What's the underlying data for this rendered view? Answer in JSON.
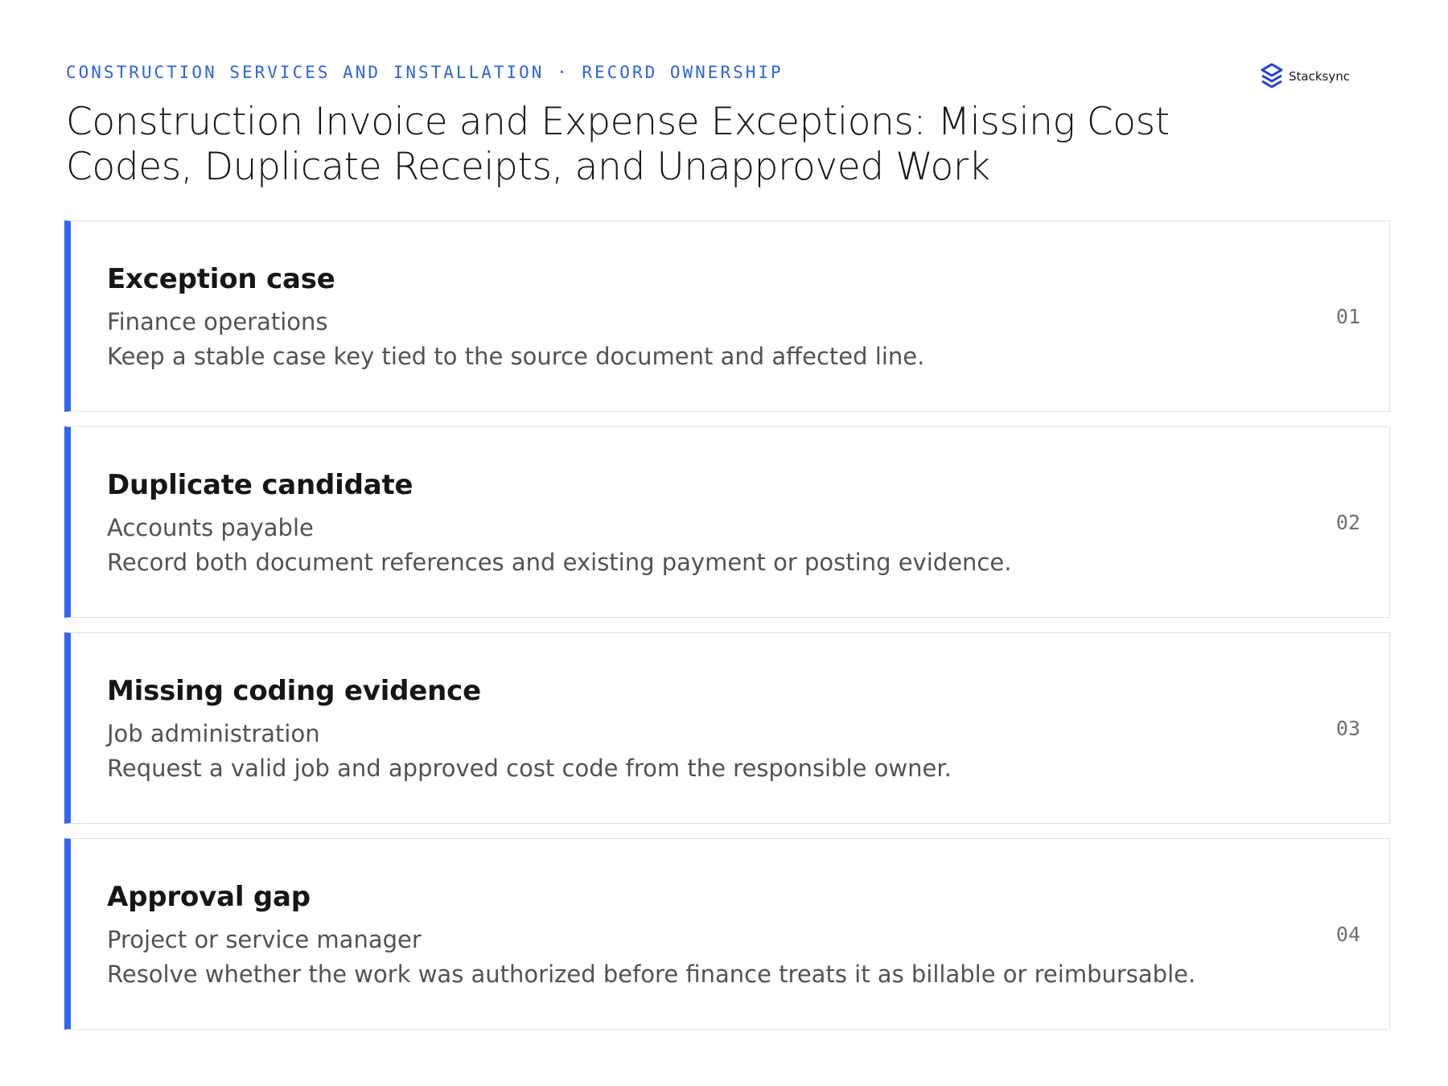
{
  "header": {
    "eyebrow": "CONSTRUCTION SERVICES AND INSTALLATION · RECORD OWNERSHIP",
    "title": "Construction Invoice and Expense Exceptions: Missing Cost Codes, Duplicate Receipts, and Unapproved Work"
  },
  "logo": {
    "text": "Stacksync",
    "icon": "stacksync-logo-icon",
    "color": "#1f3fd6"
  },
  "accent_color": "#2f66f4",
  "cards": [
    {
      "number": "01",
      "title": "Exception case",
      "owner": "Finance operations",
      "description": "Keep a stable case key tied to the source document and affected line."
    },
    {
      "number": "02",
      "title": "Duplicate candidate",
      "owner": "Accounts payable",
      "description": "Record both document references and existing payment or posting evidence."
    },
    {
      "number": "03",
      "title": "Missing coding evidence",
      "owner": "Job administration",
      "description": "Request a valid job and approved cost code from the responsible owner."
    },
    {
      "number": "04",
      "title": "Approval gap",
      "owner": "Project or service manager",
      "description": "Resolve whether the work was authorized before finance treats it as billable or reimbursable."
    }
  ]
}
